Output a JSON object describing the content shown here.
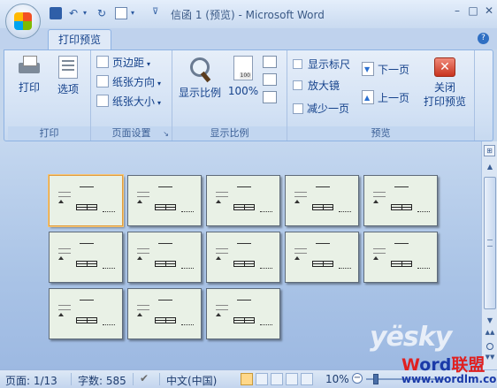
{
  "window": {
    "title": "信函 1 (预览) - Microsoft Word",
    "minimize": "–",
    "maximize": "□",
    "close": "✕"
  },
  "quick_access": {
    "undo": "↶",
    "redo": "↻",
    "dropdown": "▾",
    "customize": "⊽"
  },
  "tabs": [
    {
      "label": "打印预览",
      "active": true
    }
  ],
  "help": "?",
  "ribbon": {
    "groups": {
      "print": {
        "label": "打印",
        "buttons": {
          "print": "打印",
          "options": "选项"
        }
      },
      "page_setup": {
        "label": "页面设置",
        "buttons": {
          "margins": "页边距",
          "orientation": "纸张方向",
          "size": "纸张大小"
        },
        "launcher": "↘"
      },
      "zoom": {
        "label": "显示比例",
        "buttons": {
          "zoom": "显示比例",
          "hundred": "100%"
        }
      },
      "preview": {
        "label": "预览",
        "checkboxes": {
          "show_ruler": "显示标尺",
          "magnifier": "放大镜"
        },
        "buttons": {
          "shrink": "减少一页",
          "next_page": "下一页",
          "prev_page": "上一页",
          "close_line1": "关闭",
          "close_line2": "打印预览"
        }
      }
    }
  },
  "document": {
    "page_count": 13,
    "selected_page": 1
  },
  "scrollbar": {
    "up": "▲",
    "down": "▼",
    "prev_page": "▲▲",
    "next_page": "▼▼",
    "ruler_toggle": "⊞"
  },
  "status": {
    "page": "页面: 1/13",
    "words": "字数: 585",
    "spell": "✔",
    "language": "中文(中国)",
    "zoom": "10%",
    "zoom_minus": "−"
  },
  "watermark": {
    "yesky": "yësky",
    "word_red": "W",
    "word_blue": "ord",
    "word_union": "联盟",
    "url": "www.wordlm.com"
  },
  "colors": {
    "ribbon_bg": "#dfe9f7",
    "doc_bg": "#b3cbe9",
    "accent": "#15428b",
    "selected_page_border": "#e19c3c"
  }
}
